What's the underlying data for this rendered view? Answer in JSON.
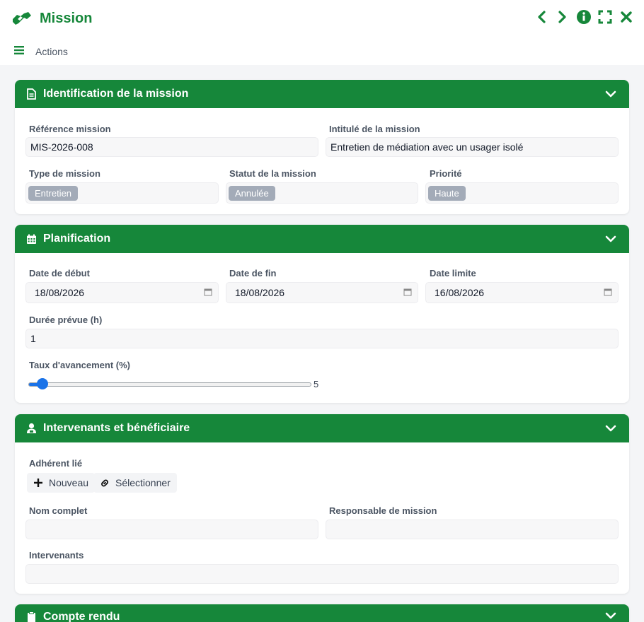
{
  "window": {
    "title": "Mission",
    "actions_label": "Actions"
  },
  "colors": {
    "brand": "#16873a",
    "tag": "#a3abb8",
    "slider": "#1a73e8"
  },
  "identification": {
    "title": "Identification de la mission",
    "reference_label": "Référence mission",
    "reference_value": "MIS-2026-008",
    "intitule_label": "Intitulé de la mission",
    "intitule_value": "Entretien de médiation avec un usager isolé",
    "type_label": "Type de mission",
    "type_value": "Entretien",
    "statut_label": "Statut de la mission",
    "statut_value": "Annulée",
    "priorite_label": "Priorité",
    "priorite_value": "Haute"
  },
  "planification": {
    "title": "Planification",
    "debut_label": "Date de début",
    "debut_value": "18/08/2026",
    "fin_label": "Date de fin",
    "fin_value": "18/08/2026",
    "limite_label": "Date limite",
    "limite_value": "16/08/2026",
    "duree_label": "Durée prévue (h)",
    "duree_value": "1",
    "taux_label": "Taux d'avancement (%)",
    "taux_value": "5",
    "taux_percent": 5
  },
  "intervenants": {
    "title": "Intervenants et bénéficiaire",
    "adherent_label": "Adhérent lié",
    "nouveau_label": "Nouveau",
    "selectionner_label": "Sélectionner",
    "nom_label": "Nom complet",
    "nom_value": "",
    "responsable_label": "Responsable de mission",
    "responsable_value": "",
    "intervenants_label": "Intervenants",
    "intervenants_value": ""
  },
  "compte_rendu": {
    "title": "Compte rendu"
  }
}
